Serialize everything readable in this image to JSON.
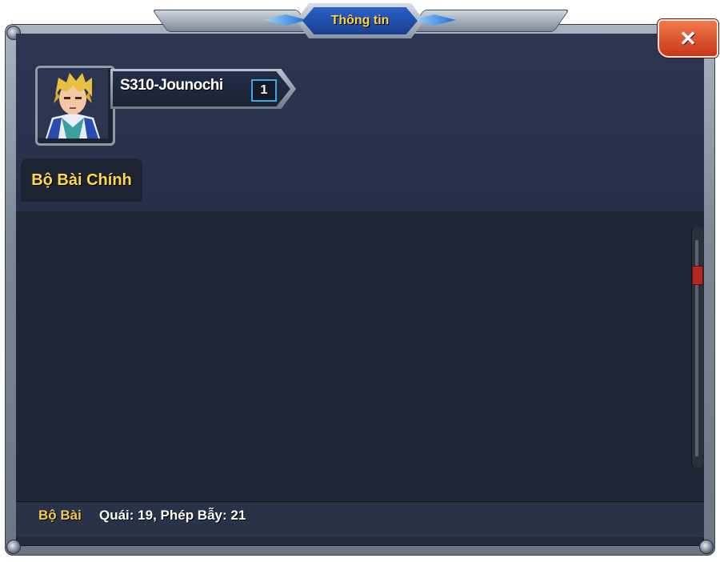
{
  "dialog": {
    "title": "Thông tin",
    "close_label": "✕"
  },
  "player": {
    "name": "S310-Jounochi",
    "level": "1"
  },
  "tabs": [
    {
      "label": "Bộ Bài Chính"
    }
  ],
  "footer": {
    "deck_label": "Bộ Bài",
    "deck_stats": "Quái: 19, Phép Bẫy: 21"
  },
  "colors": {
    "title_text": "#ffd34a",
    "tab_text": "#ffd94a",
    "close_button": "#c8361a",
    "level_border": "#3fa6e8"
  }
}
